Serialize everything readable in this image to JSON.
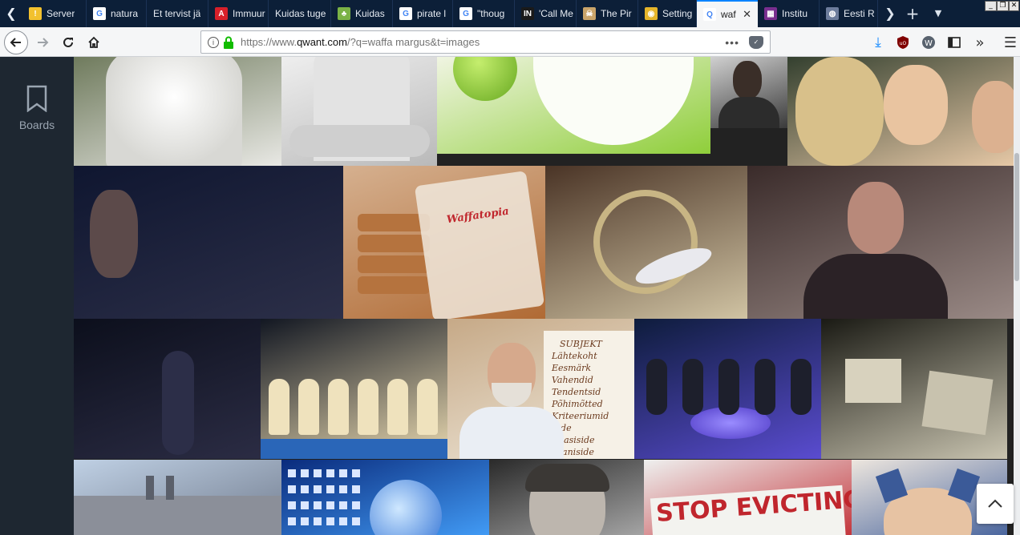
{
  "browser": {
    "tabs": [
      {
        "title": "Server",
        "favicon": "warning-icon",
        "color": "#f2c12e",
        "glyph": "!"
      },
      {
        "title": "natura",
        "favicon": "google-icon",
        "color": "#ffffff",
        "glyph": "G"
      },
      {
        "title": "Et tervist jä",
        "favicon": "",
        "color": "",
        "glyph": ""
      },
      {
        "title": "Immuur",
        "favicon": "site-icon",
        "color": "#d8202a",
        "glyph": "A"
      },
      {
        "title": "Kuidas tuge",
        "favicon": "",
        "color": "",
        "glyph": ""
      },
      {
        "title": "Kuidas",
        "favicon": "leaf-icon",
        "color": "#7bb246",
        "glyph": "♣"
      },
      {
        "title": "pirate l",
        "favicon": "google-icon",
        "color": "#ffffff",
        "glyph": "G"
      },
      {
        "title": "\"thoug",
        "favicon": "google-icon",
        "color": "#ffffff",
        "glyph": "G"
      },
      {
        "title": "'Call Me",
        "favicon": "in-icon",
        "color": "#1a1a1a",
        "glyph": "IN"
      },
      {
        "title": "The Pir",
        "favicon": "pirate-icon",
        "color": "#c9a46a",
        "glyph": "☠"
      },
      {
        "title": "Setting",
        "favicon": "chrome-icon",
        "color": "#e5b52a",
        "glyph": "◉"
      },
      {
        "title": "waf",
        "favicon": "qwant-icon",
        "color": "#ffffff",
        "glyph": "Q"
      },
      {
        "title": "Institu",
        "favicon": "pattern-icon",
        "color": "#7a2f8f",
        "glyph": "▦"
      },
      {
        "title": "Eesti R",
        "favicon": "globe-icon",
        "color": "#6d7d9c",
        "glyph": "◍"
      }
    ],
    "active_tab_index": 11,
    "url_prefix": "https://www.",
    "url_domain": "qwant.com",
    "url_rest": "/?q=waffa margus&t=images",
    "page_actions": "•••",
    "accent": "#0a84ff"
  },
  "sidebar": {
    "boards_label": "Boards"
  },
  "images": [
    {
      "id": "lace-dress",
      "colors": [
        "#6a7657",
        "#e8e8e4"
      ],
      "kind": "dress"
    },
    {
      "id": "man-shirt",
      "colors": [
        "#f1f1f1",
        "#b9b9b9"
      ],
      "kind": "shirt"
    },
    {
      "id": "apple-cup",
      "colors": [
        "#f4f6e9",
        "#8fce3a"
      ],
      "kind": "apple"
    },
    {
      "id": "portrait-bw",
      "colors": [
        "#dcdcdc",
        "#3a3a3a"
      ],
      "kind": "portrait"
    },
    {
      "id": "girls-smiling",
      "colors": [
        "#2c3a2a",
        "#e6c8a6"
      ],
      "kind": "girls"
    },
    {
      "id": "bearded-man-dark",
      "colors": [
        "#0f1630",
        "#2c2f48"
      ],
      "kind": "dark"
    },
    {
      "id": "waffle-package",
      "colors": [
        "#d5b08f",
        "#b06a34"
      ],
      "kind": "waffles",
      "label": "Waffatopia"
    },
    {
      "id": "bird-closeup",
      "colors": [
        "#4a3426",
        "#d0c3a3"
      ],
      "kind": "bird"
    },
    {
      "id": "older-man-praying",
      "colors": [
        "#3a2b2a",
        "#9a8a86"
      ],
      "kind": "man"
    },
    {
      "id": "dark-room",
      "colors": [
        "#0c0f1c",
        "#2b2c44"
      ],
      "kind": "dark2"
    },
    {
      "id": "stage-dancers",
      "colors": [
        "#121722",
        "#e9d9b0"
      ],
      "kind": "dancers"
    },
    {
      "id": "lecturer-flipchart",
      "colors": [
        "#c6a987",
        "#efe8da"
      ],
      "kind": "lecturer",
      "flipchart": [
        "SUBJEKT",
        "Lähtekoht",
        "Eesmärk",
        "Vahendid",
        "Tendentsid",
        "Põhimõtted",
        "Kriteeriumid",
        "Side",
        "Edasiside",
        "Taaniside"
      ]
    },
    {
      "id": "tv-studio",
      "colors": [
        "#0e1c3c",
        "#5a4cd0"
      ],
      "kind": "studio"
    },
    {
      "id": "computer-junk",
      "colors": [
        "#1a1a14",
        "#c9c4b0"
      ],
      "kind": "junk"
    },
    {
      "id": "city-skyline",
      "colors": [
        "#bfd0e4",
        "#6c7688"
      ],
      "kind": "city"
    },
    {
      "id": "desktop-screen",
      "colors": [
        "#0a2b7c",
        "#46a4ff"
      ],
      "kind": "desktop"
    },
    {
      "id": "young-man-bw",
      "colors": [
        "#2a2a2a",
        "#b0b0b0"
      ],
      "kind": "youngman"
    },
    {
      "id": "protest-banner",
      "colors": [
        "#eef0ef",
        "#c0262d"
      ],
      "kind": "banner",
      "banner_text": "STOP EVICTING"
    },
    {
      "id": "cat-ears-girl",
      "colors": [
        "#ede6de",
        "#3b5a98"
      ],
      "kind": "catears"
    }
  ]
}
